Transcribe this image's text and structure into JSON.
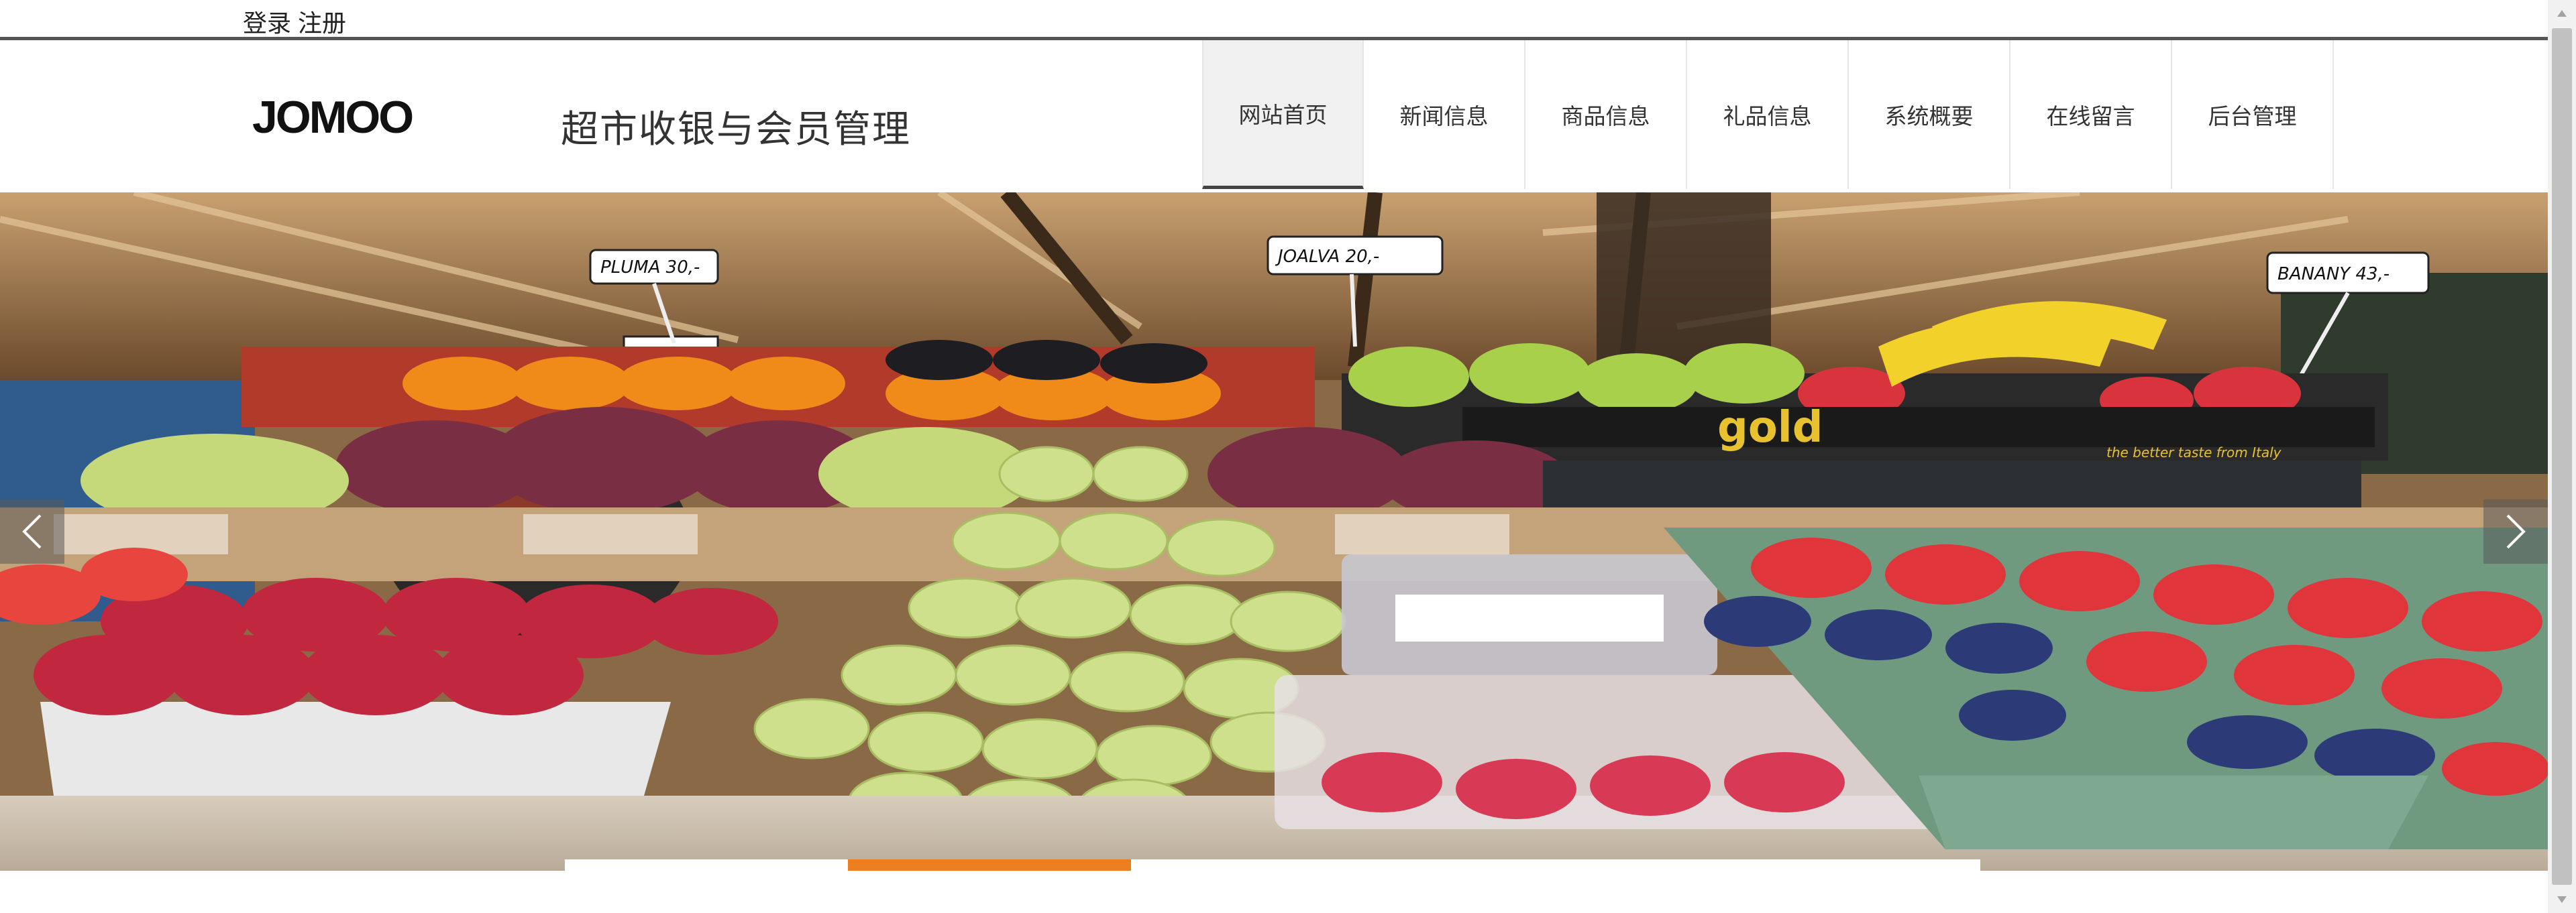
{
  "topbar": {
    "login_label": "登录",
    "register_label": "注册"
  },
  "header": {
    "logo_text": "JOMOO",
    "site_title": "超市收银与会员管理"
  },
  "nav": {
    "items": [
      {
        "label": "网站首页",
        "active": true
      },
      {
        "label": "新闻信息",
        "active": false
      },
      {
        "label": "商品信息",
        "active": false
      },
      {
        "label": "礼品信息",
        "active": false
      },
      {
        "label": "系统概要",
        "active": false
      },
      {
        "label": "在线留言",
        "active": false
      },
      {
        "label": "后台管理",
        "active": false
      }
    ]
  },
  "banner": {
    "image": "fruit-market-stall",
    "prev_icon": "chevron-left-icon",
    "next_icon": "chevron-right-icon",
    "price_tags": [
      "PLUMA 30,-",
      "JOALVA 20,-",
      "BANANY 43,-"
    ],
    "box_labels": [
      "gold",
      "the better taste from Italy"
    ]
  },
  "indicators": {
    "count": 5,
    "active_index": 1,
    "active_color": "#ee7f21"
  },
  "colors": {
    "accent": "#ee7f21",
    "nav_active_bg": "#f0f0f0",
    "nav_active_border": "#444444"
  }
}
